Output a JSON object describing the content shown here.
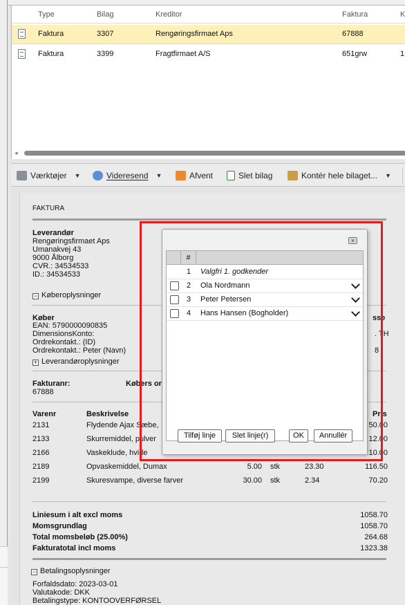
{
  "list": {
    "columns": [
      "Type",
      "Bilag",
      "Kreditor",
      "Faktura",
      "K"
    ],
    "rows": [
      {
        "type": "Faktura",
        "bilag": "3307",
        "kreditor": "Rengøringsfirmaet Aps",
        "faktura": "67888",
        "k": ""
      },
      {
        "type": "Faktura",
        "bilag": "3399",
        "kreditor": "Fragtfirmaet A/S",
        "faktura": "651grw",
        "k": "1"
      }
    ]
  },
  "toolbar": {
    "tools": "Værktøjer",
    "forward": "Videresend",
    "reject": "Afvent",
    "delete": "Slet bilag",
    "post": "Kontér hele bilaget..."
  },
  "invoice": {
    "heading": "FAKTURA",
    "supplier_label": "Leverandør",
    "supplier_lines": [
      "Rengøringsfirmaet Aps",
      "Umanakvej 43",
      "9000 Ålborg",
      "CVR.: 34534533",
      "ID.: 34534533"
    ],
    "buyer_info_toggle": "Køberoplysninger",
    "buyer_label": "Køber",
    "buyer_lines": [
      "EAN: 5790000090835",
      "DimensionsKonto:",
      "Ordrekontakt.: (ID)",
      "Ordrekontakt.: Peter (Navn)"
    ],
    "buyer_right_label": "sse",
    "buyer_right_lines": [
      ". TH",
      "8"
    ],
    "supplier_info_toggle": "Leverandøroplysninger",
    "invoice_no_label": "Fakturanr:",
    "invoice_no": "67888",
    "buyer_order_label": "Købers or",
    "col_item": "Varenr",
    "col_desc": "Beskrivelse",
    "col_price": "Pris",
    "lines": [
      {
        "item": "2131",
        "desc": "Flydende Ajax Sæbe,",
        "qty": "",
        "unit": "",
        "price": "",
        "amount": "50.00"
      },
      {
        "item": "2133",
        "desc": "Skurremiddel, pulver",
        "qty": "",
        "unit": "",
        "price": "",
        "amount": "12.00"
      },
      {
        "item": "2166",
        "desc": "Vaskeklude, hvide",
        "qty": "",
        "unit": "",
        "price": "",
        "amount": "10.00"
      },
      {
        "item": "2189",
        "desc": "Opvaskemiddel, Dumax",
        "qty": "5.00",
        "unit": "stk",
        "price": "23.30",
        "amount": "116.50"
      },
      {
        "item": "2199",
        "desc": "Skuresvampe, diverse farver",
        "qty": "30.00",
        "unit": "stk",
        "price": "2.34",
        "amount": "70.20"
      }
    ],
    "totals": [
      {
        "label": "Liniesum i alt excl moms",
        "value": "1058.70"
      },
      {
        "label": "Momsgrundlag",
        "value": "1058.70"
      },
      {
        "label": "Total momsbeløb (25.00%)",
        "value": "264.68"
      },
      {
        "label": "Fakturatotal incl moms",
        "value": "1323.38"
      }
    ],
    "payment_toggle": "Betalingsoplysninger",
    "payment_lines": [
      "Forfaldsdato: 2023-03-01",
      "Valutakode: DKK",
      "Betalingstype: KONTOOVERFØRSEL"
    ]
  },
  "dialog": {
    "col_no": "#",
    "rows": [
      {
        "no": "1",
        "label": "Valgfri 1. godkender",
        "has_check": false,
        "has_dropdown": false
      },
      {
        "no": "2",
        "label": "Ola Nordmann",
        "has_check": true,
        "has_dropdown": true
      },
      {
        "no": "3",
        "label": "Peter Petersen",
        "has_check": true,
        "has_dropdown": true
      },
      {
        "no": "4",
        "label": "Hans Hansen (Bogholder)",
        "has_check": true,
        "has_dropdown": true
      }
    ],
    "add_line": "Tilføj linje",
    "delete_line": "Slet linje(r)",
    "ok": "OK",
    "cancel": "Annullér"
  },
  "colors": {
    "selected_row": "#fdf0b8",
    "highlight_border": "#e31b1b"
  }
}
